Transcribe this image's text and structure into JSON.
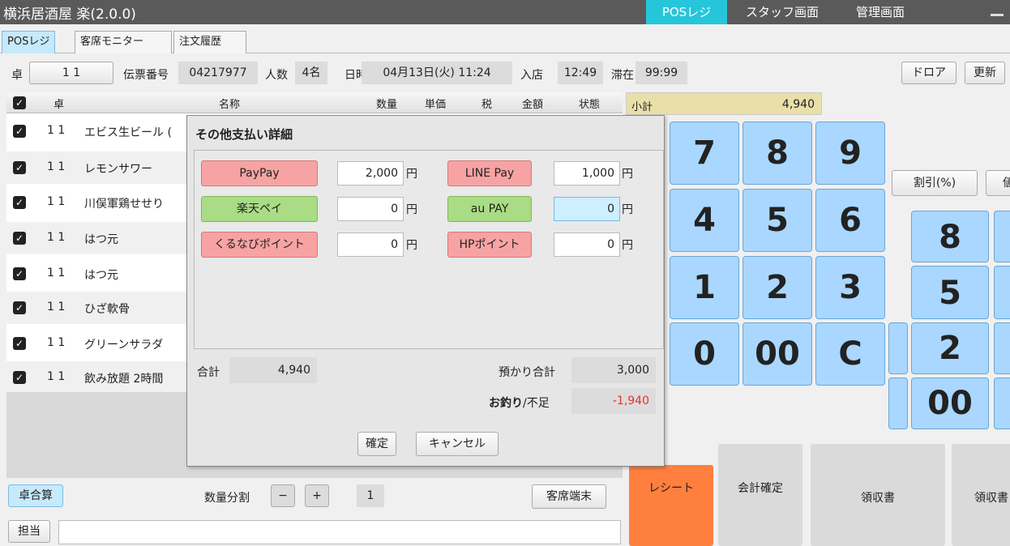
{
  "app": {
    "title": "横浜居酒屋 楽(2.0.0)",
    "nav": [
      "POSレジ",
      "スタッフ画面",
      "管理画面"
    ]
  },
  "tabs": [
    "POSレジ",
    "客席モニター",
    "注文履歴"
  ],
  "info": {
    "table_label": "卓",
    "table_value": "1 1",
    "slip_label": "伝票番号",
    "slip_value": "04217977",
    "people_label": "人数",
    "people_value": "4名",
    "datetime_label": "日時",
    "datetime_value": "04月13日(火) 11:24",
    "entry_label": "入店",
    "entry_value": "12:49",
    "stay_label": "滞在",
    "stay_value": "99:99",
    "drawer_label": "ドロア",
    "refresh_label": "更新"
  },
  "order_table": {
    "headers": [
      "卓",
      "名称",
      "数量",
      "単価",
      "税",
      "金額",
      "状態"
    ],
    "rows": [
      {
        "table": "1 1",
        "name": "エビス生ビール ("
      },
      {
        "table": "1 1",
        "name": "レモンサワー"
      },
      {
        "table": "1 1",
        "name": "川俣軍鶏せせり"
      },
      {
        "table": "1 1",
        "name": "はつ元"
      },
      {
        "table": "1 1",
        "name": "はつ元"
      },
      {
        "table": "1 1",
        "name": "ひざ軟骨"
      },
      {
        "table": "1 1",
        "name": "グリーンサラダ"
      },
      {
        "table": "1 1",
        "name": "飲み放題 2時間"
      }
    ]
  },
  "footer": {
    "merge_label": "卓合算",
    "qty_split_label": "数量分割",
    "minus_label": "−",
    "plus_label": "+",
    "qty_value": "1",
    "guest_terminal_label": "客席端末",
    "staff_label": "担当"
  },
  "right": {
    "subtotal_label": "小計",
    "subtotal_value": "4,940",
    "discount_label": "割引(%)",
    "discount_cut": "値",
    "keys_bg": [
      "8",
      "5",
      "2",
      "00"
    ],
    "receipt_label": "レシート",
    "confirm_label": "会計確定",
    "invoice_label": "領収書",
    "invoice2_label": "領収書"
  },
  "dialog": {
    "title": "その他支払い詳細",
    "payments": [
      {
        "label": "PayPay",
        "value": "2,000",
        "style": "red"
      },
      {
        "label": "LINE Pay",
        "value": "1,000",
        "style": "red"
      },
      {
        "label": "楽天ペイ",
        "value": "0",
        "style": "green"
      },
      {
        "label": "au PAY",
        "value": "0",
        "style": "green"
      },
      {
        "label": "くるなびポイント",
        "value": "0",
        "style": "red"
      },
      {
        "label": "HPポイント",
        "value": "0",
        "style": "red"
      }
    ],
    "yen": "円",
    "total_label": "合計",
    "total_value": "4,940",
    "deposit_label": "預かり合計",
    "deposit_value": "3,000",
    "change_label_bold": "お釣り",
    "change_label_rest": "/不足",
    "change_value": "-1,940",
    "change_color": "#e83030",
    "ok_label": "確定",
    "cancel_label": "キャンセル",
    "keys": [
      "7",
      "8",
      "9",
      "4",
      "5",
      "6",
      "1",
      "2",
      "3",
      "0",
      "00",
      "C"
    ]
  },
  "colors": {
    "accent_nav": "#26c6da",
    "receipt_orange": "#ff7f3f",
    "keypad_blue": "#a9d7ff"
  }
}
